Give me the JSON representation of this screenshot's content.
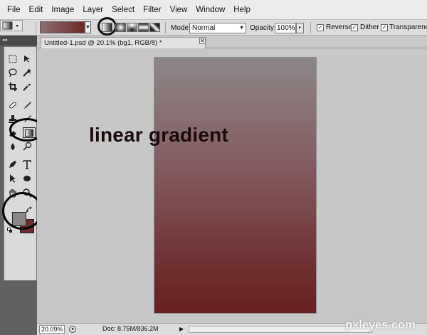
{
  "menu": {
    "items": [
      "File",
      "Edit",
      "Image",
      "Layer",
      "Select",
      "Filter",
      "View",
      "Window",
      "Help"
    ]
  },
  "options": {
    "mode_label": "Mode:",
    "mode_value": "Normal",
    "opacity_label": "Opacity:",
    "opacity_value": "100%",
    "reverse_label": "Reverse",
    "dither_label": "Dither",
    "transparency_label": "Transparency",
    "check_mark": "✓",
    "dropdown_arrow": "▼",
    "flyout_arrow": "▸",
    "gradient_start_color": "#8c6f72",
    "gradient_end_color": "#6e2a2a"
  },
  "tab": {
    "title": "Untitled-1.psd @ 20.1% (bg1, RGB/8) *",
    "close": "✕"
  },
  "toolbox": {
    "collapse_glyph": "◂◂",
    "foreground_color": "#8d8689",
    "background_color": "#6f2c2c",
    "tools": [
      "marquee-icon",
      "move-icon",
      "lasso-icon",
      "magic-wand-icon",
      "crop-icon",
      "eyedropper-icon",
      "healing-brush-icon",
      "brush-icon",
      "clone-stamp-icon",
      "history-brush-icon",
      "eraser-icon",
      "gradient-icon",
      "blur-icon",
      "dodge-icon",
      "pen-icon",
      "type-icon",
      "path-selection-icon",
      "ellipse-icon",
      "hand-icon",
      "zoom-icon"
    ]
  },
  "annotation": {
    "text": "linear gradient"
  },
  "status": {
    "zoom": "20.09%",
    "doc_info": "Doc: 8.75M/836.2M",
    "arrow": "▶"
  },
  "watermark": {
    "text": "pxleyes.com"
  }
}
